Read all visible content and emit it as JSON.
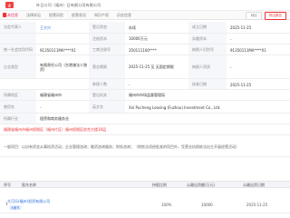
{
  "header": {
    "logo_text": "企",
    "company_tab": "叶日公司（福州）日有限公司有限公司"
  },
  "tabs": [
    "基本信息",
    "法律诉讼",
    "经营风险",
    "经营状况",
    "知识产权",
    "历史信息"
  ],
  "tools": {
    "compare": "对比",
    "download": "导出报告"
  },
  "rows": [
    {
      "label": "法定代表人",
      "value": "王大兴",
      "label2": "登记状态",
      "value2": "存续",
      "label3": "成立日期",
      "value3": "2025-11-25"
    },
    {
      "label": "",
      "value": "",
      "label2": "注册资本",
      "value2": "10000万元",
      "label3": "实缴资本",
      "value3": "-"
    },
    {
      "label": "统一社会信用代码",
      "value": "91350111MA****X1",
      "label2": "工商注册号",
      "value2": "350111100****",
      "label3": "纳税人识别号",
      "value3": "91350111MA****X1"
    },
    {
      "label": "企业类型",
      "value": "有限责任公司（台港澳法人独资）",
      "label2": "营业期限",
      "value2": "2025-11-25 至 无固定期限",
      "label3": "纳税人资质",
      "value3": "-"
    },
    {
      "label": "",
      "value": "",
      "label2": "参保人数",
      "value2": "-",
      "label3": "核准日期",
      "value3": "2025-11-25"
    },
    {
      "label": "所属地区",
      "value": "福建省福州市",
      "label2": "登记机关",
      "value2": "福州市市场监督管理局"
    },
    {
      "label": "曾用名",
      "value": "-",
      "label2": "英文名",
      "value2": "Xxl Pucheng Leasing (Fuzhou) Investment Co., Ltd."
    },
    {
      "label": "所属行业",
      "value": "租赁和商务服务业",
      "label2": "",
      "value2": ""
    }
  ],
  "address": "福建省福州市福州保税区（福州片区）福州保税区综合大楼16层",
  "scope_note": "一般项目：以自有资金从事投资活动；企业管理咨询；融资咨询服务；财务咨询；（除依法须经批准的项目外，凭营业执照依法自主开展经营活动）",
  "shareholders": {
    "headers": [
      "序号",
      "股东名称",
      "持股比例",
      "认缴出资额(万元)",
      "认缴出资日期"
    ],
    "rows": [
      {
        "no": "1",
        "name": "大可乐(福州)投资有限公司",
        "tag": "大股东",
        "ratio": "100%",
        "amount": "10000",
        "date": "2025-11-25"
      }
    ]
  }
}
